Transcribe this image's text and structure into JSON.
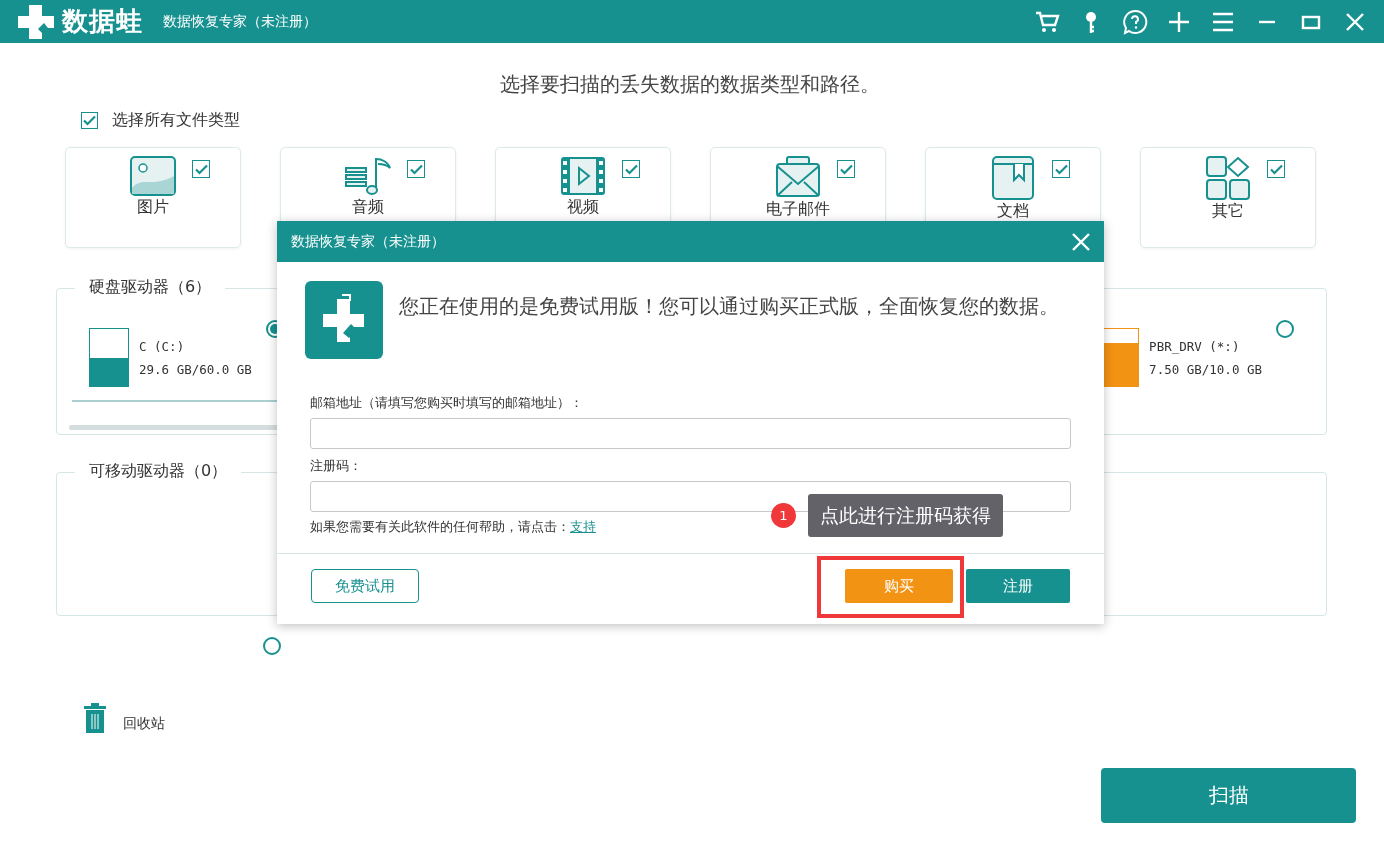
{
  "window": {
    "logo_text": "数据蛙",
    "title": "数据恢复专家（未注册）"
  },
  "heading": "选择要扫描的丢失数据的数据类型和路径。",
  "select_all": {
    "label": "选择所有文件类型",
    "checked": true
  },
  "file_types": [
    {
      "kind": "image",
      "label": "图片",
      "checked": true
    },
    {
      "kind": "audio",
      "label": "音频",
      "checked": true
    },
    {
      "kind": "video",
      "label": "视频",
      "checked": true
    },
    {
      "kind": "email",
      "label": "电子邮件",
      "checked": true
    },
    {
      "kind": "document",
      "label": "文档",
      "checked": true
    },
    {
      "kind": "other",
      "label": "其它",
      "checked": true
    }
  ],
  "hard_drives": {
    "title": "硬盘驱动器（6）",
    "drives": [
      {
        "name": "C (C:)",
        "size": "29.6 GB/60.0 GB",
        "level": 0.5,
        "color": "#17918f",
        "selected": true
      },
      {
        "name": "PBR_DRV (*:)",
        "size": "7.50 GB/10.0 GB",
        "level": 0.75,
        "color": "#f39313",
        "selected": false
      }
    ]
  },
  "removable_drives": {
    "title": "可移动驱动器（0）"
  },
  "recycle_bin": {
    "label": "回收站",
    "selected": false
  },
  "scan_button": "扫描",
  "dialog": {
    "title": "数据恢复专家（未注册）",
    "message": "您正在使用的是免费试用版！您可以通过购买正式版，全面恢复您的数据。",
    "email_label": "邮箱地址（请填写您购买时填写的邮箱地址）：",
    "code_label": "注册码：",
    "help_text": "如果您需要有关此软件的任何帮助，请点击：",
    "help_link": "支持",
    "trial_button": "免费试用",
    "buy_button": "购买",
    "register_button": "注册",
    "tooltip": {
      "step": "1",
      "text": "点此进行注册码获得"
    }
  }
}
